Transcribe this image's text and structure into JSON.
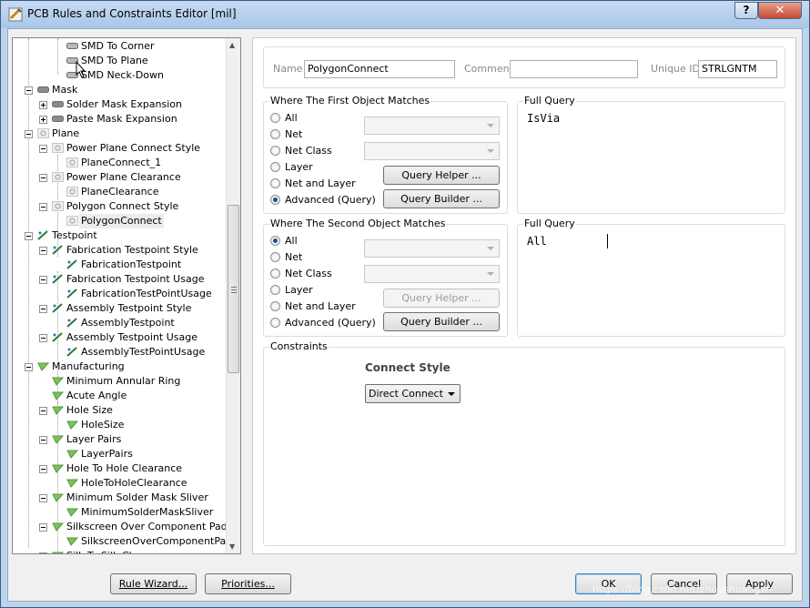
{
  "window": {
    "title": "PCB Rules and Constraints Editor [mil]",
    "help_button": "?",
    "close_button": "✕"
  },
  "tree": {
    "rows": [
      {
        "label": "SMD To Corner",
        "level": 2,
        "icon": "smd-rule-icon",
        "expander": "none"
      },
      {
        "label": "SMD To Plane",
        "level": 2,
        "icon": "smd-rule-icon",
        "expander": "none"
      },
      {
        "label": "SMD Neck-Down",
        "level": 2,
        "icon": "smd-rule-icon",
        "expander": "none"
      },
      {
        "label": "Mask",
        "level": 0,
        "icon": "mask-category-icon",
        "expander": "minus"
      },
      {
        "label": "Solder Mask Expansion",
        "level": 1,
        "icon": "mask-rule-icon",
        "expander": "plus"
      },
      {
        "label": "Paste Mask Expansion",
        "level": 1,
        "icon": "mask-rule-icon",
        "expander": "plus"
      },
      {
        "label": "Plane",
        "level": 0,
        "icon": "plane-category-icon",
        "expander": "minus"
      },
      {
        "label": "Power Plane Connect Style",
        "level": 1,
        "icon": "plane-rule-icon",
        "expander": "minus"
      },
      {
        "label": "PlaneConnect_1",
        "level": 2,
        "icon": "plane-rule-icon",
        "expander": "none"
      },
      {
        "label": "Power Plane Clearance",
        "level": 1,
        "icon": "plane-rule-icon",
        "expander": "minus"
      },
      {
        "label": "PlaneClearance",
        "level": 2,
        "icon": "plane-rule-icon",
        "expander": "none"
      },
      {
        "label": "Polygon Connect Style",
        "level": 1,
        "icon": "plane-rule-icon",
        "expander": "minus"
      },
      {
        "label": "PolygonConnect",
        "level": 2,
        "icon": "plane-rule-icon",
        "expander": "none",
        "selected": true
      },
      {
        "label": "Testpoint",
        "level": 0,
        "icon": "testpoint-category-icon",
        "expander": "minus"
      },
      {
        "label": "Fabrication Testpoint Style",
        "level": 1,
        "icon": "testpoint-rule-icon",
        "expander": "minus"
      },
      {
        "label": "FabricationTestpoint",
        "level": 2,
        "icon": "testpoint-rule-icon",
        "expander": "none"
      },
      {
        "label": "Fabrication Testpoint Usage",
        "level": 1,
        "icon": "testpoint-rule-icon",
        "expander": "minus"
      },
      {
        "label": "FabricationTestPointUsage",
        "level": 2,
        "icon": "testpoint-rule-icon",
        "expander": "none"
      },
      {
        "label": "Assembly Testpoint Style",
        "level": 1,
        "icon": "testpoint-rule-icon",
        "expander": "minus"
      },
      {
        "label": "AssemblyTestpoint",
        "level": 2,
        "icon": "testpoint-rule-icon",
        "expander": "none"
      },
      {
        "label": "Assembly Testpoint Usage",
        "level": 1,
        "icon": "testpoint-rule-icon",
        "expander": "minus"
      },
      {
        "label": "AssemblyTestPointUsage",
        "level": 2,
        "icon": "testpoint-rule-icon",
        "expander": "none"
      },
      {
        "label": "Manufacturing",
        "level": 0,
        "icon": "manufacturing-category-icon",
        "expander": "minus"
      },
      {
        "label": "Minimum Annular Ring",
        "level": 1,
        "icon": "manufacturing-rule-icon",
        "expander": "none"
      },
      {
        "label": "Acute Angle",
        "level": 1,
        "icon": "manufacturing-rule-icon",
        "expander": "none"
      },
      {
        "label": "Hole Size",
        "level": 1,
        "icon": "manufacturing-rule-icon",
        "expander": "minus"
      },
      {
        "label": "HoleSize",
        "level": 2,
        "icon": "manufacturing-rule-icon",
        "expander": "none"
      },
      {
        "label": "Layer Pairs",
        "level": 1,
        "icon": "manufacturing-rule-icon",
        "expander": "minus"
      },
      {
        "label": "LayerPairs",
        "level": 2,
        "icon": "manufacturing-rule-icon",
        "expander": "none"
      },
      {
        "label": "Hole To Hole Clearance",
        "level": 1,
        "icon": "manufacturing-rule-icon",
        "expander": "minus"
      },
      {
        "label": "HoleToHoleClearance",
        "level": 2,
        "icon": "manufacturing-rule-icon",
        "expander": "none"
      },
      {
        "label": "Minimum Solder Mask Sliver",
        "level": 1,
        "icon": "manufacturing-rule-icon",
        "expander": "minus"
      },
      {
        "label": "MinimumSolderMaskSliver",
        "level": 2,
        "icon": "manufacturing-rule-icon",
        "expander": "none"
      },
      {
        "label": "Silkscreen Over Component Pads",
        "level": 1,
        "icon": "manufacturing-rule-icon",
        "expander": "minus"
      },
      {
        "label": "SilkscreenOverComponentPac",
        "level": 2,
        "icon": "manufacturing-rule-icon",
        "expander": "none"
      },
      {
        "label": "Silk To Silk Clearance",
        "level": 1,
        "icon": "manufacturing-rule-icon",
        "expander": "minus"
      }
    ]
  },
  "rule": {
    "name_label": "Name",
    "name_value": "PolygonConnect",
    "comment_label": "Comment",
    "comment_value": "",
    "uid_label": "Unique ID",
    "uid_value": "STRLGNTM"
  },
  "first_match": {
    "title": "Where The First Object Matches",
    "options": [
      "All",
      "Net",
      "Net Class",
      "Layer",
      "Net and Layer",
      "Advanced (Query)"
    ],
    "selected": "Advanced (Query)",
    "query_helper": "Query Helper ...",
    "query_builder": "Query Builder ...",
    "full_query_title": "Full Query",
    "full_query": "IsVia"
  },
  "second_match": {
    "title": "Where The Second Object Matches",
    "options": [
      "All",
      "Net",
      "Net Class",
      "Layer",
      "Net and Layer",
      "Advanced (Query)"
    ],
    "selected": "All",
    "query_helper": "Query Helper ...",
    "query_builder": "Query Builder ...",
    "full_query_title": "Full Query",
    "full_query": "All"
  },
  "constraints": {
    "title": "Constraints",
    "connect_style_label": "Connect Style",
    "connect_style_value": "Direct Connect"
  },
  "footer": {
    "rule_wizard": "Rule Wizard...",
    "priorities": "Priorities...",
    "ok": "OK",
    "cancel": "Cancel",
    "apply": "Apply"
  },
  "watermark": "https://blog.csdn.net/zhoushuangsh"
}
